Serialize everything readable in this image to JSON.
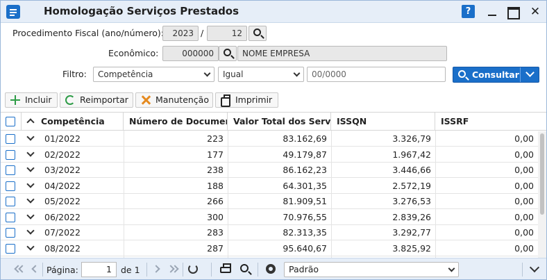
{
  "window": {
    "title": "Homologação Serviços Prestados",
    "help_label": "?",
    "close_label": "✕"
  },
  "form": {
    "procedimento_label": "Procedimento Fiscal (ano/número):",
    "ano": "2023",
    "separator": "/",
    "numero": "12",
    "economico_label": "Econômico:",
    "economico_codigo": "000000",
    "economico_nome": "NOME EMPRESA",
    "filtro_label": "Filtro:",
    "filtro_campo": "Competência",
    "filtro_operador": "Igual",
    "filtro_valor_placeholder": "00/0000",
    "consultar_label": "Consultar"
  },
  "toolbar": {
    "incluir": "Incluir",
    "reimportar": "Reimportar",
    "manutencao": "Manutenção",
    "imprimir": "Imprimir"
  },
  "grid": {
    "columns": [
      "Competência",
      "Número de Documen…",
      "Valor Total dos Servi…",
      "ISSQN",
      "ISSRF"
    ],
    "rows": [
      {
        "competencia": "01/2022",
        "numero": "223",
        "valor": "83.162,69",
        "issqn": "3.326,79",
        "issrf": "0,00"
      },
      {
        "competencia": "02/2022",
        "numero": "177",
        "valor": "49.179,87",
        "issqn": "1.967,42",
        "issrf": "0,00"
      },
      {
        "competencia": "03/2022",
        "numero": "238",
        "valor": "86.162,23",
        "issqn": "3.446,66",
        "issrf": "0,00"
      },
      {
        "competencia": "04/2022",
        "numero": "188",
        "valor": "64.301,35",
        "issqn": "2.572,19",
        "issrf": "0,00"
      },
      {
        "competencia": "05/2022",
        "numero": "266",
        "valor": "81.909,51",
        "issqn": "3.276,53",
        "issrf": "0,00"
      },
      {
        "competencia": "06/2022",
        "numero": "300",
        "valor": "70.976,55",
        "issqn": "2.839,26",
        "issrf": "0,00"
      },
      {
        "competencia": "07/2022",
        "numero": "283",
        "valor": "82.313,35",
        "issqn": "3.292,77",
        "issrf": "0,00"
      },
      {
        "competencia": "08/2022",
        "numero": "287",
        "valor": "95.640,67",
        "issqn": "3.825,92",
        "issrf": "0,00"
      }
    ]
  },
  "pager": {
    "pagina_label": "Página:",
    "pagina_value": "1",
    "de_label": "de 1",
    "layout_value": "Padrão"
  },
  "colors": {
    "accent": "#1a6fc9",
    "titlebar_bg": "#e6eef8",
    "add_green": "#2e9c47",
    "tools_orange": "#e58a1f"
  }
}
